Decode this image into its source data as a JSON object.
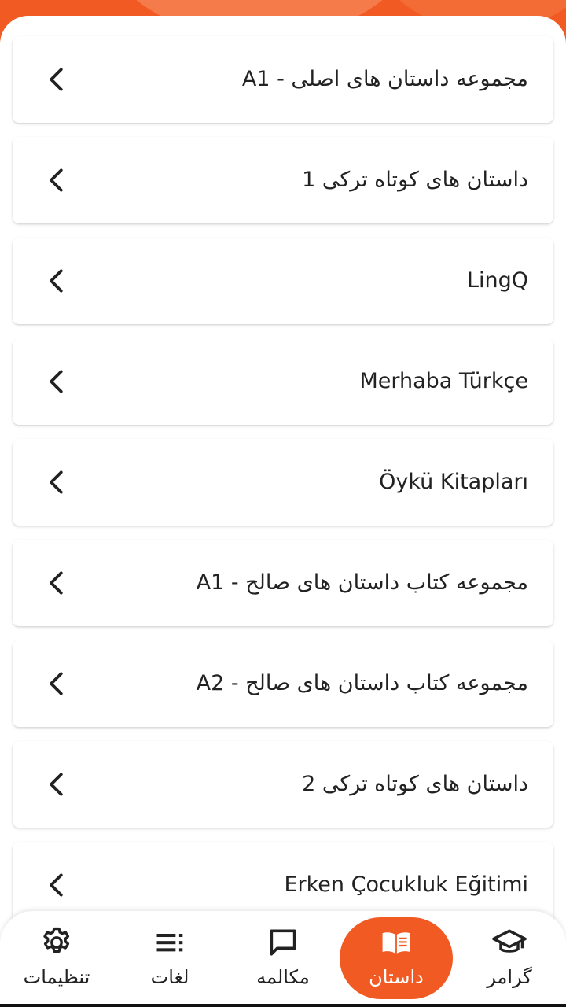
{
  "theme": {
    "accent": "#f15a22",
    "accent_light": "#f57b4a",
    "text": "#222222",
    "card_bg": "#ffffff"
  },
  "stories": [
    {
      "title": "مجموعه داستان های اصلی - A1",
      "icon": "chevron-left-icon"
    },
    {
      "title": "داستان های کوتاه ترکی 1",
      "icon": "chevron-left-icon"
    },
    {
      "title": "LingQ",
      "icon": "chevron-left-icon"
    },
    {
      "title": "Merhaba Türkçe",
      "icon": "chevron-left-icon"
    },
    {
      "title": "Öykü Kitapları",
      "icon": "chevron-left-icon"
    },
    {
      "title": "مجموعه کتاب داستان های صالح - A1",
      "icon": "chevron-left-icon"
    },
    {
      "title": "مجموعه کتاب داستان های صالح - A2",
      "icon": "chevron-left-icon"
    },
    {
      "title": "داستان های کوتاه ترکی 2",
      "icon": "chevron-left-icon"
    },
    {
      "title": "Erken Çocukluk Eğitimi",
      "icon": "chevron-left-icon"
    }
  ],
  "nav": {
    "settings": {
      "label": "تنظیمات",
      "icon": "gear-icon"
    },
    "vocabulary": {
      "label": "لغات",
      "icon": "list-icon"
    },
    "conversation": {
      "label": "مکالمه",
      "icon": "chat-bubble-icon"
    },
    "stories": {
      "label": "داستان",
      "icon": "book-icon",
      "active": true
    },
    "grammar": {
      "label": "گرامر",
      "icon": "graduation-cap-icon"
    }
  }
}
